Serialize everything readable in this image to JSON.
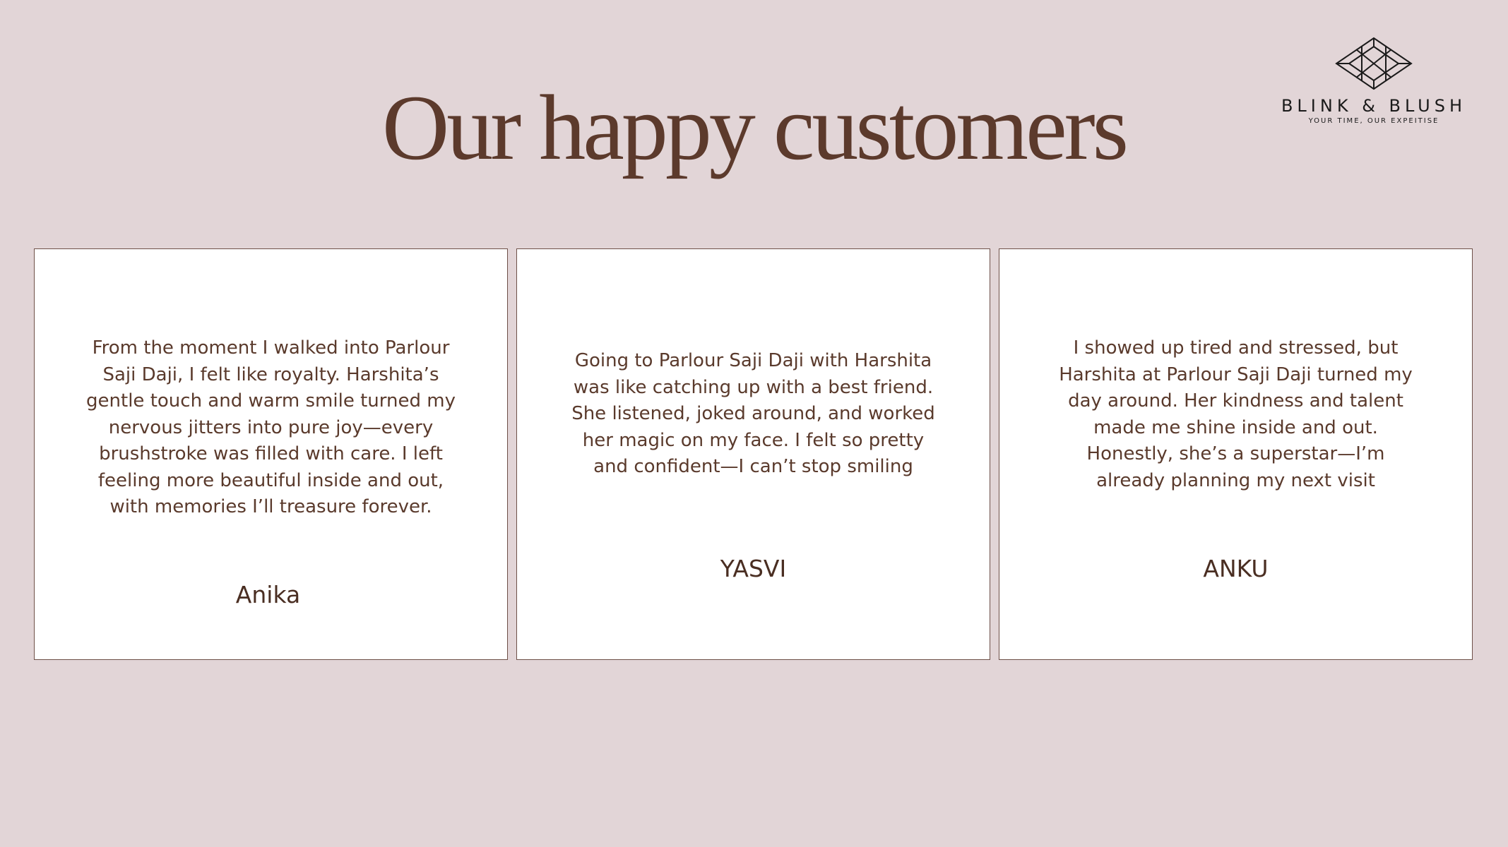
{
  "title": "Our happy customers",
  "brand": {
    "name": "BLINK & BLUSH",
    "tagline": "YOUR TIME, OUR EXPEITISE",
    "logo_icon": "diamond-icon"
  },
  "testimonials": [
    {
      "quote": "From the moment I walked into Parlour Saji Daji, I felt like royalty. Harshita’s gentle touch and warm smile turned my nervous jitters into pure joy—every brushstroke was filled with care. I left feeling more beautiful inside and out, with memories I’ll treasure forever.",
      "name": "Anika"
    },
    {
      "quote": "Going to Parlour Saji Daji with Harshita was like catching up with a best friend. She listened, joked around, and worked her magic on my face. I felt so pretty and confident—I can’t stop smiling",
      "name": "YASVI"
    },
    {
      "quote": "I showed up tired and stressed, but Harshita at Parlour Saji Daji turned my day around. Her kindness and talent made me shine inside and out. Honestly, she’s a superstar—I’m already planning my next visit",
      "name": "ANKU"
    }
  ],
  "colors": {
    "background": "#e2d5d7",
    "heading": "#5c3a2c",
    "card_border": "#6e5048",
    "text": "#5a3a2c"
  }
}
